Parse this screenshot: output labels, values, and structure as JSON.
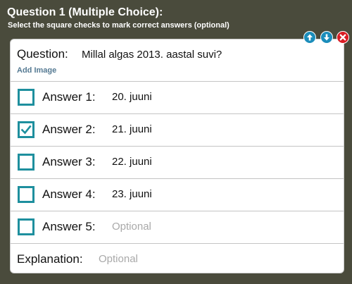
{
  "header": {
    "title": "Question 1 (Multiple Choice):",
    "subtitle": "Select the square checks to mark correct answers (optional)"
  },
  "controls": {
    "move_up_icon": "arrow-up-icon",
    "move_down_icon": "arrow-down-icon",
    "delete_icon": "close-icon"
  },
  "question": {
    "label": "Question:",
    "value": "Millal algas 2013. aastal suvi?",
    "add_image": "Add Image"
  },
  "answers": [
    {
      "label": "Answer 1:",
      "value": "20. juuni",
      "checked": false
    },
    {
      "label": "Answer 2:",
      "value": "21. juuni",
      "checked": true
    },
    {
      "label": "Answer 3:",
      "value": "22. juuni",
      "checked": false
    },
    {
      "label": "Answer 4:",
      "value": "23. juuni",
      "checked": false
    },
    {
      "label": "Answer 5:",
      "value": "",
      "placeholder": "Optional",
      "checked": false
    }
  ],
  "explanation": {
    "label": "Explanation:",
    "value": "",
    "placeholder": "Optional"
  },
  "colors": {
    "background": "#4a4b3c",
    "checkbox_border": "#1e8f9e",
    "arrow_button": "#1b8dbb",
    "delete_button": "#d91c24",
    "link": "#557a93",
    "placeholder": "#a9a9a9"
  }
}
